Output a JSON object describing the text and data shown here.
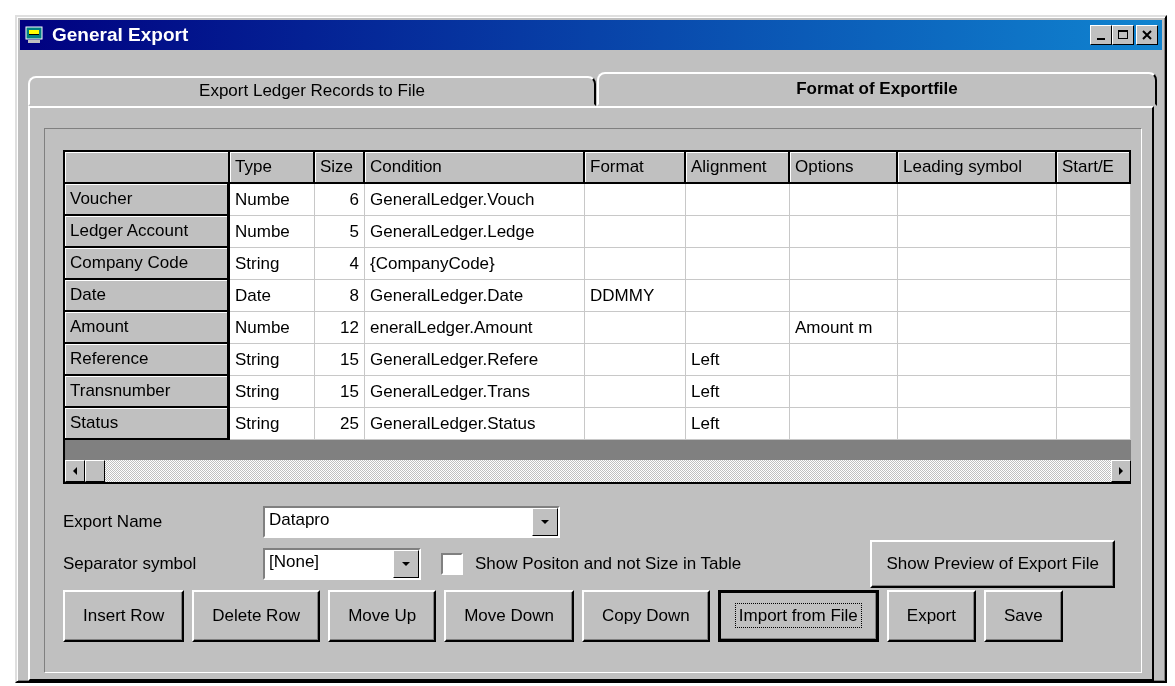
{
  "window": {
    "title": "General Export"
  },
  "tabs": [
    {
      "label": "Export Ledger Records to File",
      "selected": false
    },
    {
      "label": "Format of Exportfile",
      "selected": true
    }
  ],
  "table": {
    "columns": [
      "Type",
      "Size",
      "Condition",
      "Format",
      "Alignment",
      "Options",
      "Leading symbol",
      "Start/E"
    ],
    "rows": [
      {
        "name": "Voucher",
        "cells": [
          "Numbe",
          "6",
          "GeneralLedger.Vouch",
          null,
          null,
          null,
          null,
          null
        ]
      },
      {
        "name": "Ledger Account",
        "cells": [
          "Numbe",
          "5",
          "GeneralLedger.Ledge",
          null,
          null,
          null,
          null,
          null
        ]
      },
      {
        "name": "Company Code",
        "cells": [
          "String",
          "4",
          "{CompanyCode}",
          null,
          null,
          null,
          null,
          null
        ]
      },
      {
        "name": "Date",
        "cells": [
          "Date",
          "8",
          "GeneralLedger.Date",
          "DDMMY",
          null,
          null,
          null,
          null
        ]
      },
      {
        "name": "Amount",
        "cells": [
          "Numbe",
          "12",
          "eneralLedger.Amount",
          null,
          null,
          "Amount m",
          null,
          null
        ]
      },
      {
        "name": "Reference",
        "cells": [
          "String",
          "15",
          "GeneralLedger.Refere",
          null,
          "Left",
          null,
          null,
          null
        ]
      },
      {
        "name": "Transnumber",
        "cells": [
          "String",
          "15",
          "GeneralLedger.Trans",
          null,
          "Left",
          null,
          null,
          null
        ]
      },
      {
        "name": "Status",
        "cells": [
          "String",
          "25",
          "GeneralLedger.Status",
          null,
          "Left",
          null,
          null,
          null
        ]
      }
    ]
  },
  "export_name": {
    "label": "Export Name",
    "value": "Datapro"
  },
  "separator": {
    "label": "Separator symbol",
    "value": "[None]"
  },
  "show_position": {
    "label": "Show Positon and not Size in Table",
    "checked": false
  },
  "preview_button": "Show Preview of Export File",
  "buttons": [
    {
      "label": "Insert Row",
      "focused": false
    },
    {
      "label": "Delete Row",
      "focused": false
    },
    {
      "label": "Move Up",
      "focused": false
    },
    {
      "label": "Move Down",
      "focused": false
    },
    {
      "label": "Copy Down",
      "focused": false
    },
    {
      "label": "Import from File",
      "focused": true
    },
    {
      "label": "Export",
      "focused": false
    },
    {
      "label": "Save",
      "focused": false
    }
  ]
}
